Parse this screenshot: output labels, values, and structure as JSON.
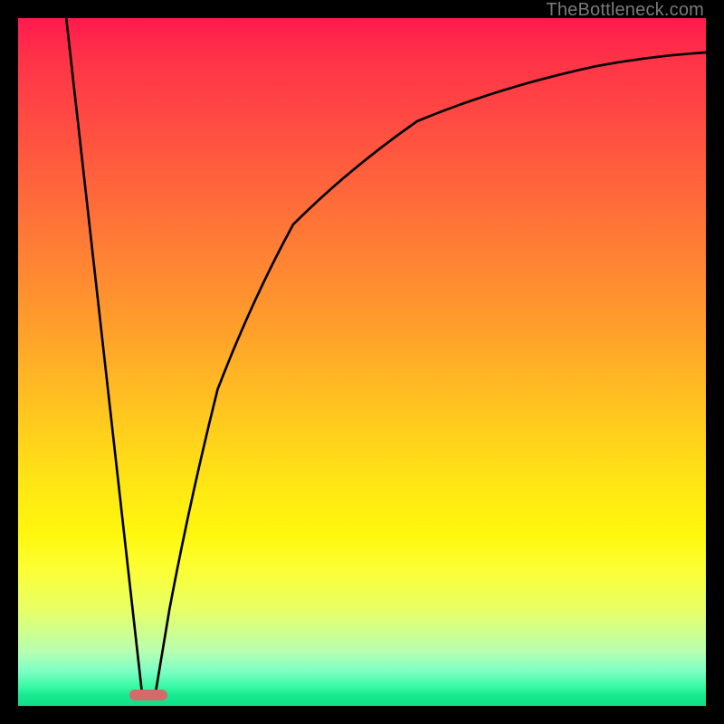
{
  "watermark": {
    "text": "TheBottleneck.com"
  },
  "chart_data": {
    "type": "line",
    "title": "",
    "xlabel": "",
    "ylabel": "",
    "xlim": [
      0,
      100
    ],
    "ylim": [
      0,
      100
    ],
    "grid": false,
    "legend": false,
    "gradient_stops": [
      {
        "pos": 0,
        "color": "#ff1a4d"
      },
      {
        "pos": 18,
        "color": "#ff5340"
      },
      {
        "pos": 46,
        "color": "#ffa22a"
      },
      {
        "pos": 68,
        "color": "#ffe714"
      },
      {
        "pos": 86,
        "color": "#e8ff66"
      },
      {
        "pos": 100,
        "color": "#10df88"
      }
    ],
    "series": [
      {
        "name": "left-line",
        "x": [
          7,
          18
        ],
        "y": [
          100,
          2
        ]
      },
      {
        "name": "right-curve",
        "x": [
          20,
          22,
          25,
          29,
          34,
          40,
          48,
          58,
          70,
          84,
          100
        ],
        "y": [
          2,
          14,
          30,
          46,
          59,
          70,
          78,
          85,
          90,
          93,
          95
        ]
      }
    ],
    "marker": {
      "x_center": 19,
      "width_pct": 5.2,
      "y_bottom_pct": 1.5,
      "color": "#d46a6a"
    }
  }
}
